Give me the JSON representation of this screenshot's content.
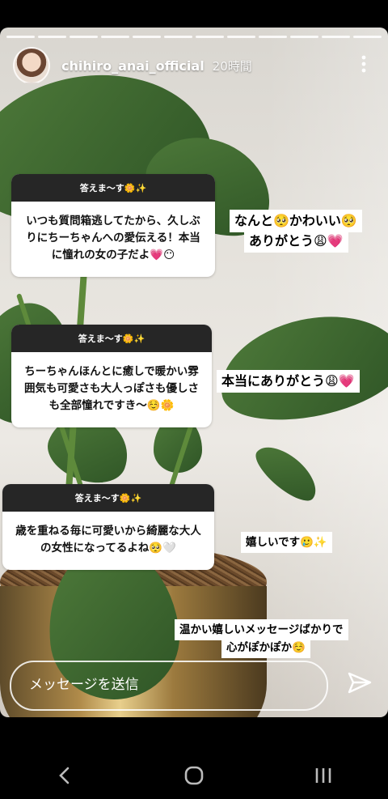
{
  "story": {
    "username": "chihiro_anai_official",
    "time_ago": "20時間",
    "progress_segments": 12
  },
  "qa": [
    {
      "header": "答えま〜す🌼✨",
      "question": "いつも質問箱逃してたから、久しぶりにちーちゃんへの愛伝える！本当に憧れの女の子だよ💗😶",
      "reply_lines": [
        "なんと🥺かわいい🥺",
        "ありがとう😩💗"
      ]
    },
    {
      "header": "答えま〜す🌼✨",
      "question": "ちーちゃんほんとに癒しで暖かい雰囲気も可愛さも大人っぽさも優しさも全部憧れですき〜☺️🌼",
      "reply_lines": [
        "本当にありがとう😩💗"
      ]
    },
    {
      "header": "答えま〜す🌼✨",
      "question": "歳を重ねる毎に可愛いから綺麗な大人の女性になってるよね🥺🤍",
      "reply_lines": [
        "嬉しいです🥲✨"
      ]
    }
  ],
  "closing_lines": [
    "温かい嬉しいメッセージばかりで",
    "心がぽかぽか☺️"
  ],
  "message_bar": {
    "placeholder": "メッセージを送信"
  },
  "icons": {
    "more": "more-vertical-icon",
    "send": "send-icon",
    "back": "back-chevron-icon",
    "home": "home-circle-icon",
    "recents": "recents-icon"
  }
}
